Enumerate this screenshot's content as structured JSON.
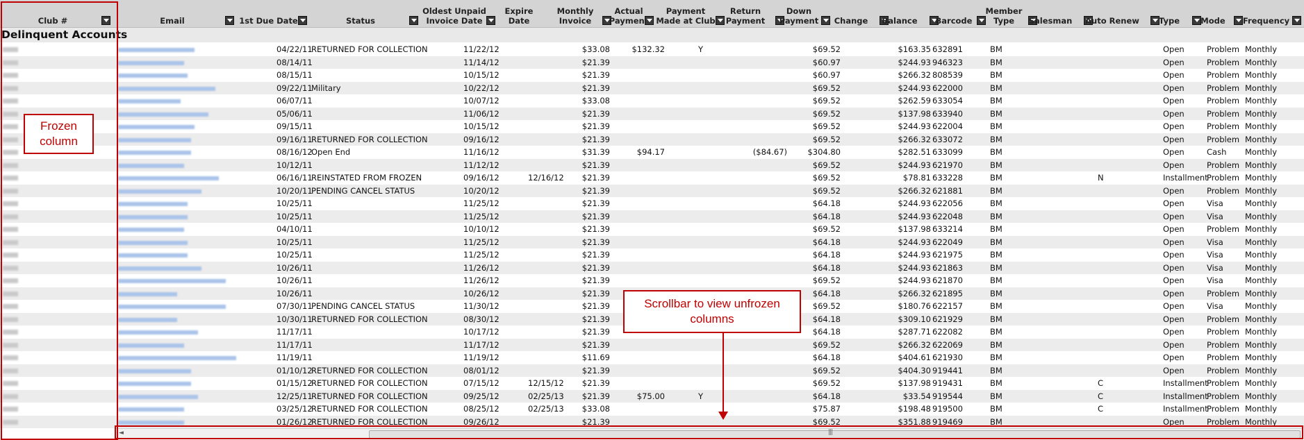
{
  "group_label": "Delinquent Accounts",
  "columns": {
    "club": "Club #",
    "email": "Email",
    "due": "1st Due Date",
    "status": "Status",
    "oldest": "Oldest Unpaid\nInvoice Date",
    "expire": "Expire Date",
    "monthly": "Monthly\nInvoice",
    "actual": "Actual\nPayment",
    "made": "Payment\nMade at Club",
    "ret": "Return\nPayment",
    "down": "Down\nPayment",
    "change": "Change",
    "balance": "Balance",
    "barcode": "Barcode",
    "member": "Member\nType",
    "salesman": "Salesman",
    "renew": "Auto Renew",
    "type": "Type",
    "mode": "Mode",
    "freq": "Frequency"
  },
  "rows": [
    {
      "due": "04/22/11",
      "status": "RETURNED FOR COLLECTION",
      "oldest": "11/22/12",
      "expire": "",
      "monthly": "$33.08",
      "actual": "$132.32",
      "made": "Y",
      "ret": "",
      "down": "$69.52",
      "balance": "$163.35",
      "barcode": "632891",
      "member": "BM",
      "renew": "",
      "type": "Open",
      "mode": "Problem",
      "freq": "Monthly"
    },
    {
      "due": "08/14/11",
      "status": "",
      "oldest": "11/14/12",
      "expire": "",
      "monthly": "$21.39",
      "actual": "",
      "made": "",
      "ret": "",
      "down": "$60.97",
      "balance": "$244.93",
      "barcode": "946323",
      "member": "BM",
      "renew": "",
      "type": "Open",
      "mode": "Problem",
      "freq": "Monthly"
    },
    {
      "due": "08/15/11",
      "status": "",
      "oldest": "10/15/12",
      "expire": "",
      "monthly": "$21.39",
      "actual": "",
      "made": "",
      "ret": "",
      "down": "$60.97",
      "balance": "$266.32",
      "barcode": "808539",
      "member": "BM",
      "renew": "",
      "type": "Open",
      "mode": "Problem",
      "freq": "Monthly"
    },
    {
      "due": "09/22/11",
      "status": "Military",
      "oldest": "10/22/12",
      "expire": "",
      "monthly": "$21.39",
      "actual": "",
      "made": "",
      "ret": "",
      "down": "$69.52",
      "balance": "$244.93",
      "barcode": "622000",
      "member": "BM",
      "renew": "",
      "type": "Open",
      "mode": "Problem",
      "freq": "Monthly"
    },
    {
      "due": "06/07/11",
      "status": "",
      "oldest": "10/07/12",
      "expire": "",
      "monthly": "$33.08",
      "actual": "",
      "made": "",
      "ret": "",
      "down": "$69.52",
      "balance": "$262.59",
      "barcode": "633054",
      "member": "BM",
      "renew": "",
      "type": "Open",
      "mode": "Problem",
      "freq": "Monthly"
    },
    {
      "due": "05/06/11",
      "status": "",
      "oldest": "11/06/12",
      "expire": "",
      "monthly": "$21.39",
      "actual": "",
      "made": "",
      "ret": "",
      "down": "$69.52",
      "balance": "$137.98",
      "barcode": "633940",
      "member": "BM",
      "renew": "",
      "type": "Open",
      "mode": "Problem",
      "freq": "Monthly"
    },
    {
      "due": "09/15/11",
      "status": "",
      "oldest": "10/15/12",
      "expire": "",
      "monthly": "$21.39",
      "actual": "",
      "made": "",
      "ret": "",
      "down": "$69.52",
      "balance": "$244.93",
      "barcode": "622004",
      "member": "BM",
      "renew": "",
      "type": "Open",
      "mode": "Problem",
      "freq": "Monthly"
    },
    {
      "due": "09/16/11",
      "status": "RETURNED FOR COLLECTION",
      "oldest": "09/16/12",
      "expire": "",
      "monthly": "$21.39",
      "actual": "",
      "made": "",
      "ret": "",
      "down": "$69.52",
      "balance": "$266.32",
      "barcode": "633072",
      "member": "BM",
      "renew": "",
      "type": "Open",
      "mode": "Problem",
      "freq": "Monthly"
    },
    {
      "due": "08/16/12",
      "status": "Open End",
      "oldest": "11/16/12",
      "expire": "",
      "monthly": "$31.39",
      "actual": "$94.17",
      "made": "",
      "ret": "($84.67)",
      "down": "$304.80",
      "balance": "$282.51",
      "barcode": "633099",
      "member": "BM",
      "renew": "",
      "type": "Open",
      "mode": "Cash",
      "freq": "Monthly"
    },
    {
      "due": "10/12/11",
      "status": "",
      "oldest": "11/12/12",
      "expire": "",
      "monthly": "$21.39",
      "actual": "",
      "made": "",
      "ret": "",
      "down": "$69.52",
      "balance": "$244.93",
      "barcode": "621970",
      "member": "BM",
      "renew": "",
      "type": "Open",
      "mode": "Problem",
      "freq": "Monthly"
    },
    {
      "due": "06/16/11",
      "status": "REINSTATED FROM FROZEN",
      "oldest": "09/16/12",
      "expire": "12/16/12",
      "monthly": "$21.39",
      "actual": "",
      "made": "",
      "ret": "",
      "down": "$69.52",
      "balance": "$78.81",
      "barcode": "633228",
      "member": "BM",
      "renew": "N",
      "type": "Installment",
      "mode": "Problem",
      "freq": "Monthly"
    },
    {
      "due": "10/20/11",
      "status": "PENDING CANCEL STATUS",
      "oldest": "10/20/12",
      "expire": "",
      "monthly": "$21.39",
      "actual": "",
      "made": "",
      "ret": "",
      "down": "$69.52",
      "balance": "$266.32",
      "barcode": "621881",
      "member": "BM",
      "renew": "",
      "type": "Open",
      "mode": "Problem",
      "freq": "Monthly"
    },
    {
      "due": "10/25/11",
      "status": "",
      "oldest": "11/25/12",
      "expire": "",
      "monthly": "$21.39",
      "actual": "",
      "made": "",
      "ret": "",
      "down": "$64.18",
      "balance": "$244.93",
      "barcode": "622056",
      "member": "BM",
      "renew": "",
      "type": "Open",
      "mode": "Visa",
      "freq": "Monthly"
    },
    {
      "due": "10/25/11",
      "status": "",
      "oldest": "11/25/12",
      "expire": "",
      "monthly": "$21.39",
      "actual": "",
      "made": "",
      "ret": "",
      "down": "$64.18",
      "balance": "$244.93",
      "barcode": "622048",
      "member": "BM",
      "renew": "",
      "type": "Open",
      "mode": "Visa",
      "freq": "Monthly"
    },
    {
      "due": "04/10/11",
      "status": "",
      "oldest": "10/10/12",
      "expire": "",
      "monthly": "$21.39",
      "actual": "",
      "made": "",
      "ret": "",
      "down": "$69.52",
      "balance": "$137.98",
      "barcode": "633214",
      "member": "BM",
      "renew": "",
      "type": "Open",
      "mode": "Problem",
      "freq": "Monthly"
    },
    {
      "due": "10/25/11",
      "status": "",
      "oldest": "11/25/12",
      "expire": "",
      "monthly": "$21.39",
      "actual": "",
      "made": "",
      "ret": "",
      "down": "$64.18",
      "balance": "$244.93",
      "barcode": "622049",
      "member": "BM",
      "renew": "",
      "type": "Open",
      "mode": "Visa",
      "freq": "Monthly"
    },
    {
      "due": "10/25/11",
      "status": "",
      "oldest": "11/25/12",
      "expire": "",
      "monthly": "$21.39",
      "actual": "",
      "made": "",
      "ret": "",
      "down": "$64.18",
      "balance": "$244.93",
      "barcode": "621975",
      "member": "BM",
      "renew": "",
      "type": "Open",
      "mode": "Visa",
      "freq": "Monthly"
    },
    {
      "due": "10/26/11",
      "status": "",
      "oldest": "11/26/12",
      "expire": "",
      "monthly": "$21.39",
      "actual": "",
      "made": "",
      "ret": "",
      "down": "$64.18",
      "balance": "$244.93",
      "barcode": "621863",
      "member": "BM",
      "renew": "",
      "type": "Open",
      "mode": "Visa",
      "freq": "Monthly"
    },
    {
      "due": "10/26/11",
      "status": "",
      "oldest": "11/26/12",
      "expire": "",
      "monthly": "$21.39",
      "actual": "",
      "made": "",
      "ret": "",
      "down": "$69.52",
      "balance": "$244.93",
      "barcode": "621870",
      "member": "BM",
      "renew": "",
      "type": "Open",
      "mode": "Visa",
      "freq": "Monthly"
    },
    {
      "due": "10/26/11",
      "status": "",
      "oldest": "10/26/12",
      "expire": "",
      "monthly": "$21.39",
      "actual": "",
      "made": "",
      "ret": "",
      "down": "$64.18",
      "balance": "$266.32",
      "barcode": "621895",
      "member": "BM",
      "renew": "",
      "type": "Open",
      "mode": "Problem",
      "freq": "Monthly"
    },
    {
      "due": "07/30/11",
      "status": "PENDING CANCEL STATUS",
      "oldest": "11/30/12",
      "expire": "",
      "monthly": "$21.39",
      "actual": "",
      "made": "",
      "ret": "",
      "down": "$69.52",
      "balance": "$180.76",
      "barcode": "622157",
      "member": "BM",
      "renew": "",
      "type": "Open",
      "mode": "Visa",
      "freq": "Monthly"
    },
    {
      "due": "10/30/11",
      "status": "RETURNED FOR COLLECTION",
      "oldest": "08/30/12",
      "expire": "",
      "monthly": "$21.39",
      "actual": "",
      "made": "",
      "ret": "",
      "down": "$64.18",
      "balance": "$309.10",
      "barcode": "621929",
      "member": "BM",
      "renew": "",
      "type": "Open",
      "mode": "Problem",
      "freq": "Monthly"
    },
    {
      "due": "11/17/11",
      "status": "",
      "oldest": "10/17/12",
      "expire": "",
      "monthly": "$21.39",
      "actual": "",
      "made": "",
      "ret": "",
      "down": "$64.18",
      "balance": "$287.71",
      "barcode": "622082",
      "member": "BM",
      "renew": "",
      "type": "Open",
      "mode": "Problem",
      "freq": "Monthly"
    },
    {
      "due": "11/17/11",
      "status": "",
      "oldest": "11/17/12",
      "expire": "",
      "monthly": "$21.39",
      "actual": "",
      "made": "",
      "ret": "",
      "down": "$69.52",
      "balance": "$266.32",
      "barcode": "622069",
      "member": "BM",
      "renew": "",
      "type": "Open",
      "mode": "Problem",
      "freq": "Monthly"
    },
    {
      "due": "11/19/11",
      "status": "",
      "oldest": "11/19/12",
      "expire": "",
      "monthly": "$11.69",
      "actual": "",
      "made": "",
      "ret": "",
      "down": "$64.18",
      "balance": "$404.61",
      "barcode": "621930",
      "member": "BM",
      "renew": "",
      "type": "Open",
      "mode": "Problem",
      "freq": "Monthly"
    },
    {
      "due": "01/10/12",
      "status": "RETURNED FOR COLLECTION",
      "oldest": "08/01/12",
      "expire": "",
      "monthly": "$21.39",
      "actual": "",
      "made": "",
      "ret": "",
      "down": "$69.52",
      "balance": "$404.30",
      "barcode": "919441",
      "member": "BM",
      "renew": "",
      "type": "Open",
      "mode": "Problem",
      "freq": "Monthly"
    },
    {
      "due": "01/15/12",
      "status": "RETURNED FOR COLLECTION",
      "oldest": "07/15/12",
      "expire": "12/15/12",
      "monthly": "$21.39",
      "actual": "",
      "made": "",
      "ret": "",
      "down": "$69.52",
      "balance": "$137.98",
      "barcode": "919431",
      "member": "BM",
      "renew": "C",
      "type": "Installment",
      "mode": "Problem",
      "freq": "Monthly"
    },
    {
      "due": "12/25/11",
      "status": "RETURNED FOR COLLECTION",
      "oldest": "09/25/12",
      "expire": "02/25/13",
      "monthly": "$21.39",
      "actual": "$75.00",
      "made": "Y",
      "ret": "",
      "down": "$64.18",
      "balance": "$33.54",
      "barcode": "919544",
      "member": "BM",
      "renew": "C",
      "type": "Installment",
      "mode": "Problem",
      "freq": "Monthly"
    },
    {
      "due": "03/25/12",
      "status": "RETURNED FOR COLLECTION",
      "oldest": "08/25/12",
      "expire": "02/25/13",
      "monthly": "$33.08",
      "actual": "",
      "made": "",
      "ret": "",
      "down": "$75.87",
      "balance": "$198.48",
      "barcode": "919500",
      "member": "BM",
      "renew": "C",
      "type": "Installment",
      "mode": "Problem",
      "freq": "Monthly"
    },
    {
      "due": "01/26/12",
      "status": "RETURNED FOR COLLECTION",
      "oldest": "09/26/12",
      "expire": "",
      "monthly": "$21.39",
      "actual": "",
      "made": "",
      "ret": "",
      "down": "$69.52",
      "balance": "$351.88",
      "barcode": "919469",
      "member": "BM",
      "renew": "",
      "type": "Open",
      "mode": "Problem",
      "freq": "Monthly"
    }
  ],
  "annotations": {
    "frozen": "Frozen\ncolumn",
    "scroll": "Scrollbar to view unfrozen\ncolumns"
  },
  "scrollbar": {
    "grip": "|||"
  },
  "colors": {
    "accent": "#c00000",
    "header_bg": "#d4d4d4",
    "email_link": "#a9c3ea"
  }
}
